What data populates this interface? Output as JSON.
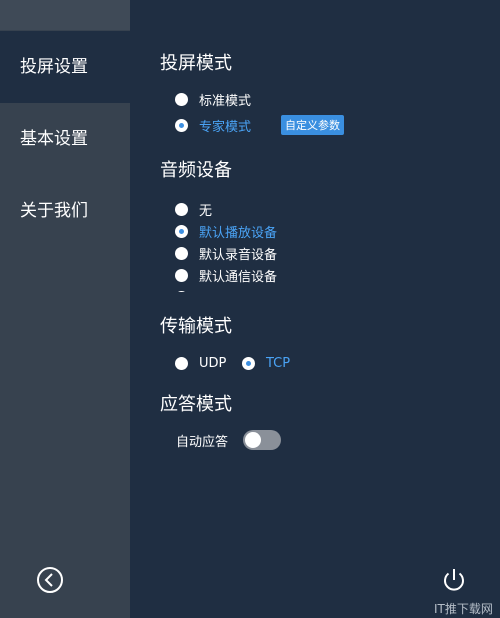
{
  "sidebar": {
    "items": [
      {
        "label": "投屏设置"
      },
      {
        "label": "基本设置"
      },
      {
        "label": "关于我们"
      }
    ],
    "back_icon": "chevron-left-circle-icon"
  },
  "cast_mode": {
    "title": "投屏模式",
    "options": [
      {
        "label": "标准模式",
        "selected": false
      },
      {
        "label": "专家模式",
        "selected": true
      }
    ],
    "custom_params_label": "自定义参数"
  },
  "audio_device": {
    "title": "音频设备",
    "options": [
      {
        "label": "无",
        "selected": false
      },
      {
        "label": "默认播放设备",
        "selected": true
      },
      {
        "label": "默认录音设备",
        "selected": false
      },
      {
        "label": "默认通信设备",
        "selected": false
      }
    ]
  },
  "transfer_mode": {
    "title": "传输模式",
    "options": [
      {
        "label": "UDP",
        "selected": false
      },
      {
        "label": "TCP",
        "selected": true
      }
    ]
  },
  "answer_mode": {
    "title": "应答模式",
    "auto_answer_label": "自动应答",
    "auto_answer_on": false
  },
  "power_icon": "power-icon",
  "watermark": "IT推下载网",
  "colors": {
    "accent": "#3d8fe0",
    "background": "#1f2e42",
    "sidebar": "#37424f"
  }
}
